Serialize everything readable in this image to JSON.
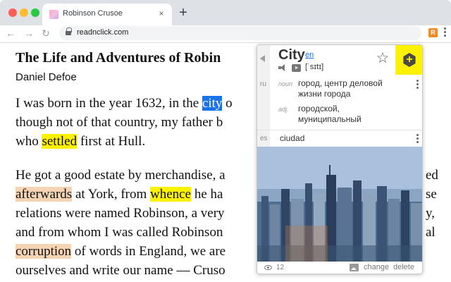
{
  "browser": {
    "tab_title": "Robinson Crusoe",
    "tab_close": "×",
    "new_tab": "+",
    "nav": {
      "back": "←",
      "forward": "→",
      "reload": "↻"
    },
    "url": "readnclick.com",
    "extension_icon_label": "R",
    "icons": [
      "lock-icon",
      "extension-icon",
      "menu-icon"
    ]
  },
  "book": {
    "title": "The Life and Adventures of Robin",
    "author": "Daniel Defoe",
    "paragraph1": {
      "l1_a": "I was born in the year 1632, in the ",
      "l1_hl": "city",
      "l1_b": " o",
      "l2": "though not of that country, my father b",
      "l3_a": "who ",
      "l3_hl": "settled",
      "l3_b": " first at Hull."
    },
    "paragraph2": {
      "l1": "He got a good estate by merchandise, a",
      "l1_end": "ed",
      "l2_hl1": "afterwards",
      "l2_a": " at York, from ",
      "l2_hl2": "whence",
      "l2_b": " he ha",
      "l2_end": "se",
      "l3": "relations were named Robinson, a very",
      "l3_end": "y,",
      "l4": "and from whom I was called Robinson",
      "l4_end": "al",
      "l5_hl": "corruption",
      "l5_a": " of words in England, we are",
      "l6": "ourselves and write our name — Cruso"
    },
    "highlight_colors": {
      "selected": "#1a73e8",
      "saved": "#fff200",
      "learned": "#f5d3b3"
    }
  },
  "popup": {
    "word": "City",
    "word_lang": "en",
    "transcription": "[ˈsɪtɪ]",
    "ru": {
      "lang": "ru",
      "entries": [
        {
          "pos": "noun",
          "text_l1": "город, центр деловой",
          "text_l2": "жизни города"
        },
        {
          "pos": "adj.",
          "text_l1": "городской,",
          "text_l2": "муниципальный"
        }
      ]
    },
    "es": {
      "lang": "es",
      "text": "ciudad"
    },
    "footer": {
      "views": "12",
      "change": "change",
      "delete": "delete"
    },
    "add_symbol": "+",
    "star_symbol": "☆",
    "icons": [
      "back-arrow-icon",
      "speaker-icon",
      "video-icon",
      "star-icon",
      "add-word-icon",
      "eye-icon",
      "image-icon"
    ]
  }
}
